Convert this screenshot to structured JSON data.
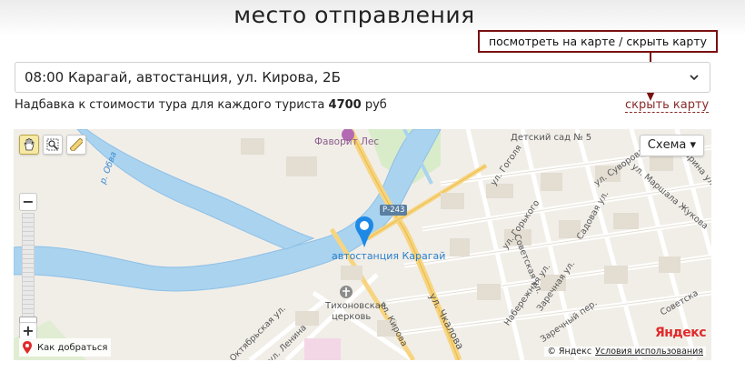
{
  "page": {
    "title": "место отправления"
  },
  "callout": {
    "text": "посмотреть на карте / скрыть карту",
    "border_color": "#7a1010"
  },
  "departure_select": {
    "value": "08:00 Карагай, автостанция, ул. Кирова, 2Б"
  },
  "surcharge": {
    "text_before": "Надбавка к стоимости тура для каждого туриста ",
    "amount": "4700",
    "currency": " руб"
  },
  "map_toggle": {
    "label": "скрыть карту",
    "color": "#8a2a2a"
  },
  "map": {
    "scheme_button": "Схема ▾",
    "zoom_in": "+",
    "zoom_out": "−",
    "route_link": "Как добраться",
    "attribution": "© Яндекс",
    "terms_link": "Условия использования",
    "logo": "Яндекс",
    "tools": [
      "hand-icon",
      "zoom-area-icon",
      "ruler-icon"
    ],
    "marker_label": "автостанция Карагай",
    "labels": {
      "favorit": "Фаворит Лес",
      "kindergarten": "Детский сад № 5",
      "church_1": "Тихоновская",
      "church_2": "церковь",
      "road": "Р-243",
      "river": "р. Обва",
      "gogolya": "ул. Гоголя",
      "suvorova": "ул. Суворова",
      "marshala": "ул. Маршала Жукова",
      "gagarina": "Гагарина ул.",
      "gorkogo": "ул. Горького",
      "sadovaya": "Садовая ул.",
      "sovetskaya": "Советская ул.",
      "zarechnaya": "Заречная ул.",
      "naberezhnaya": "Набережная ул.",
      "zarechny_per": "Заречный пер.",
      "kirova": "ул. Кирова",
      "chkalova": "ул. Чкалова",
      "oktyabrskaya": "Октябрьская ул.",
      "lenina": "ул. Ленина",
      "sovetsk_short": "Советска"
    },
    "colors": {
      "river": "#a9d3ef",
      "river_edge": "#8fc0e6",
      "land": "#f1eee8",
      "green": "#d9ecc9",
      "major_road": "#f7d580",
      "marker": "#1e88e5"
    }
  }
}
